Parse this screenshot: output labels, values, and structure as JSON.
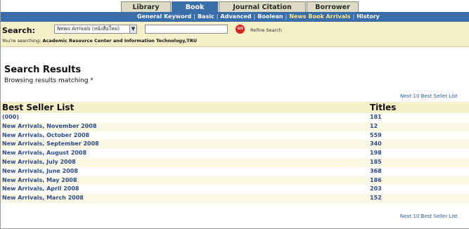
{
  "tabs": [
    {
      "label": "Library Hours",
      "active": false
    },
    {
      "label": "Book Search",
      "active": true
    },
    {
      "label": "Journal Citation Search",
      "active": false
    },
    {
      "label": "Borrower Info.",
      "active": false
    }
  ],
  "subnav": {
    "items": [
      "General Keyword",
      "Basic",
      "Advanced",
      "Boolean",
      "News Book Arrivals",
      "History"
    ],
    "current": "News Book Arrivals"
  },
  "search": {
    "label": "Search:",
    "scope_value": "News Arrivals (หนังสือใหม่)",
    "input_value": "",
    "go_label": "GO",
    "refine_label": "Refine Search",
    "scope_prefix": "You're searching:",
    "scope_name": "Academic Resource Center and Information Technology,TRU"
  },
  "results": {
    "title": "Search Results",
    "browse_text": "Browsing results matching *",
    "next_label": "Next 10 Best Seller List",
    "col_list": "Best Seller List",
    "col_titles": "Titles",
    "rows": [
      {
        "name": "(000)",
        "titles": "181"
      },
      {
        "name": "New Arrivals, November 2008",
        "titles": "12"
      },
      {
        "name": "New Arrivals, October 2008",
        "titles": "559"
      },
      {
        "name": "New Arrivals, September 2008",
        "titles": "340"
      },
      {
        "name": "New Arrivals, August 2008",
        "titles": "198"
      },
      {
        "name": "New Arrivals, July 2008",
        "titles": "185"
      },
      {
        "name": "New Arrivals, June 2008",
        "titles": "368"
      },
      {
        "name": "New Arrivals, May 2008",
        "titles": "186"
      },
      {
        "name": "New Arrivals, April 2008",
        "titles": "203"
      },
      {
        "name": "New Arrivals, March 2008",
        "titles": "152"
      }
    ]
  },
  "colors": {
    "nav_blue": "#3a6ea8",
    "tab_inactive": "#dcdcc6",
    "search_bg": "#f4efc8",
    "link_blue": "#2c4a8a",
    "go_red": "#d8221c"
  }
}
